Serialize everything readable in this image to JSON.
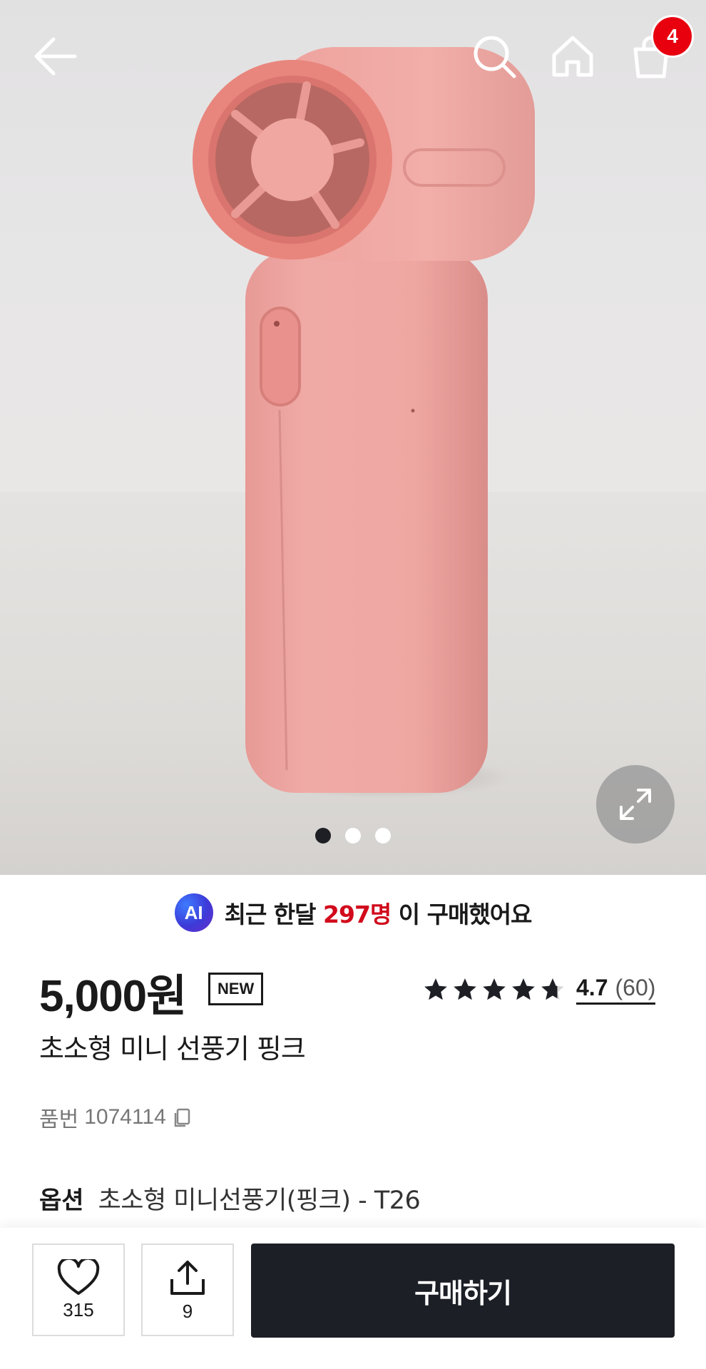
{
  "header": {
    "back_icon": "arrow-left-icon",
    "search_icon": "search-icon",
    "home_icon": "home-icon",
    "cart_icon": "shopping-bag-icon",
    "cart_badge": "4",
    "badge_color": "#e8000f"
  },
  "gallery": {
    "slide_count": 3,
    "active_slide": 1,
    "expand_icon": "expand-icon",
    "product_color": "#efa8a4"
  },
  "ai_summary": {
    "badge": "AI",
    "prefix": "최근 한달",
    "count": "297명",
    "suffix": "이 구매했어요",
    "highlight_color": "#d10a1c"
  },
  "product": {
    "price": "5,000원",
    "new_tag": "NEW",
    "rating_stars": 4.7,
    "rating_value": "4.7",
    "review_count": "(60)",
    "title": "초소형 미니 선풍기 핑크",
    "sku_label": "품번",
    "sku_value": "1074114",
    "copy_icon": "copy-icon",
    "option_label": "옵션",
    "option_value": "초소형 미니선풍기(핑크) - T26"
  },
  "bottom_bar": {
    "like_icon": "heart-icon",
    "like_count": "315",
    "share_icon": "share-icon",
    "share_count": "9",
    "buy_label": "구매하기",
    "buy_color": "#1d1f26"
  }
}
